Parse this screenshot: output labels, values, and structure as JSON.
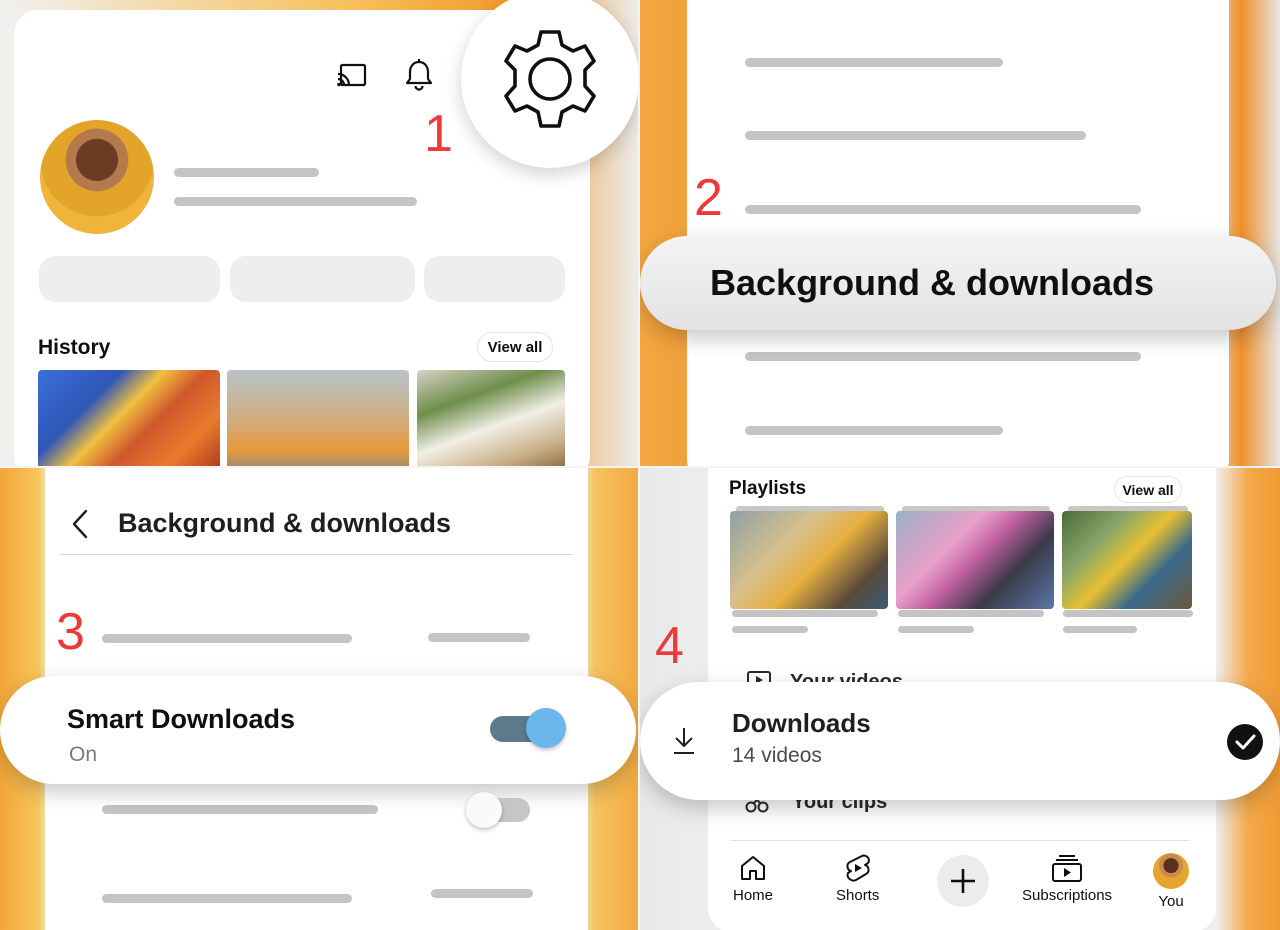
{
  "steps": {
    "one": "1",
    "two": "2",
    "three": "3",
    "four": "4"
  },
  "icons": {
    "cast": "cast-icon",
    "notifications": "bell-icon",
    "settings": "gear-icon",
    "back": "chevron-left-icon",
    "video": "play-square-icon",
    "download": "download-icon",
    "check": "check-circle-icon",
    "clips": "scissors-icon",
    "home": "home-icon",
    "shorts": "shorts-icon",
    "create": "plus-icon",
    "subscriptions": "subscriptions-icon"
  },
  "profile": {
    "history_title": "History",
    "history_view_all": "View all"
  },
  "settings_menu": {
    "highlighted_item": "Background & downloads"
  },
  "background_downloads": {
    "header_title": "Background & downloads",
    "smart_downloads_title": "Smart Downloads",
    "smart_downloads_status": "On",
    "smart_downloads_enabled": true,
    "second_toggle_enabled": false
  },
  "library": {
    "playlists_title": "Playlists",
    "playlists_view_all": "View all",
    "your_videos_label": "Your videos",
    "downloads_title": "Downloads",
    "downloads_count": "14 videos",
    "your_clips_label": "Your clips",
    "nav": {
      "home": "Home",
      "shorts": "Shorts",
      "subscriptions": "Subscriptions",
      "you": "You"
    }
  },
  "colors": {
    "step_number": "#ea3a3a",
    "toggle_track_on": "#5c7a8a",
    "toggle_knob_on": "#6bb6ea",
    "accent_orange": "#f29a2c"
  }
}
